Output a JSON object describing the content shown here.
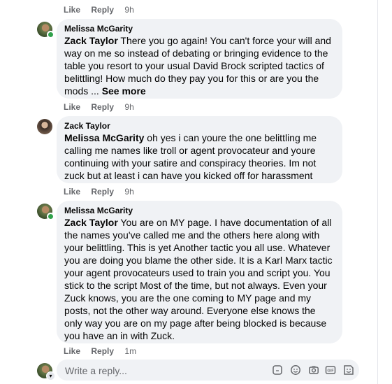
{
  "comments": [
    {
      "actions": {
        "like": "Like",
        "reply": "Reply",
        "time": "9h"
      }
    },
    {
      "author": "Melissa McGarity",
      "mention": "Zack Taylor",
      "text": " There you go again! You can't force your will and way on me so instead of debating or bringing evidence to the table you resort to your usual David Brock scripted tactics of belittling! How much do they pay you for this or are you the mods ... ",
      "see_more": "See more",
      "actions": {
        "like": "Like",
        "reply": "Reply",
        "time": "9h"
      }
    },
    {
      "author": "Zack Taylor",
      "mention": "Melissa McGarity",
      "text": " oh yes i can youre the one belittling me calling me names like troll or agent provocateur and youre continuing with your satire and conspiracy theories. Im not zuck but at least i can have you kicked off for harassment",
      "actions": {
        "like": "Like",
        "reply": "Reply",
        "time": "9h"
      }
    },
    {
      "author": "Melissa McGarity",
      "mention": "Zack Taylor",
      "text": " You are on MY page. I have documentation of all the names you've called me and the others here along with your belittling. This is yet Another tactic you all use. Whatever you are doing you blame the other side. It is a Karl Marx tactic your agent provocateurs used to train you and script you. You stick to the script Most of the time, but not always. Even your Zuck knows, you are the one coming to MY page and my posts, not the other way around. Everyone else knows the only way you are on my page after being blocked is because you have an in with Zuck.",
      "actions": {
        "like": "Like",
        "reply": "Reply",
        "time": "1m"
      }
    }
  ],
  "composer": {
    "placeholder": "Write a reply...",
    "icons": [
      "sticker-icon",
      "emoji-icon",
      "camera-icon",
      "gif-icon",
      "sticker-face-icon"
    ]
  },
  "colors": {
    "bubble": "#f0f2f5",
    "meta": "#65676b",
    "online": "#31a24c"
  }
}
